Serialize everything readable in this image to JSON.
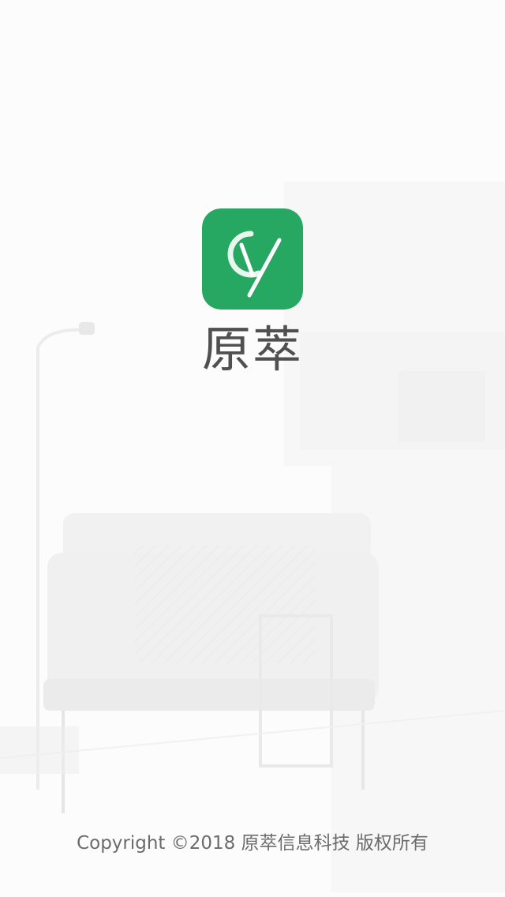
{
  "app": {
    "name": "原萃",
    "icon_color": "#27a862"
  },
  "footer": {
    "copyright": "Copyright ©2018 原萃信息科技 版权所有"
  }
}
